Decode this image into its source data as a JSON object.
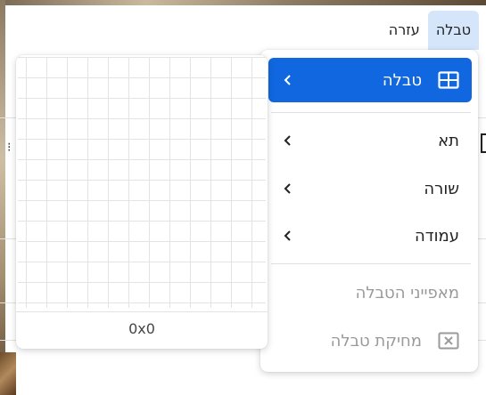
{
  "menubar": {
    "items": [
      {
        "label": "טבלה",
        "active": true
      },
      {
        "label": "עזרה",
        "active": false
      }
    ]
  },
  "table_menu": {
    "items": [
      {
        "label": "טבלה",
        "icon": "table-icon",
        "submenu": true,
        "selected": true,
        "disabled": false
      },
      {
        "label": "תא",
        "icon": null,
        "submenu": true,
        "selected": false,
        "disabled": false
      },
      {
        "label": "שורה",
        "icon": null,
        "submenu": true,
        "selected": false,
        "disabled": false
      },
      {
        "label": "עמודה",
        "icon": null,
        "submenu": true,
        "selected": false,
        "disabled": false
      },
      {
        "label": "מאפייני הטבלה",
        "icon": null,
        "submenu": false,
        "selected": false,
        "disabled": true
      },
      {
        "label": "מחיקת טבלה",
        "icon": "delete-table-icon",
        "submenu": false,
        "selected": false,
        "disabled": true
      }
    ]
  },
  "grid_picker": {
    "size_label": "0x0"
  },
  "colors": {
    "selected_bg": "#1067df",
    "active_menubar_bg": "#d5e6fb",
    "disabled_text": "#9a9a9a"
  }
}
